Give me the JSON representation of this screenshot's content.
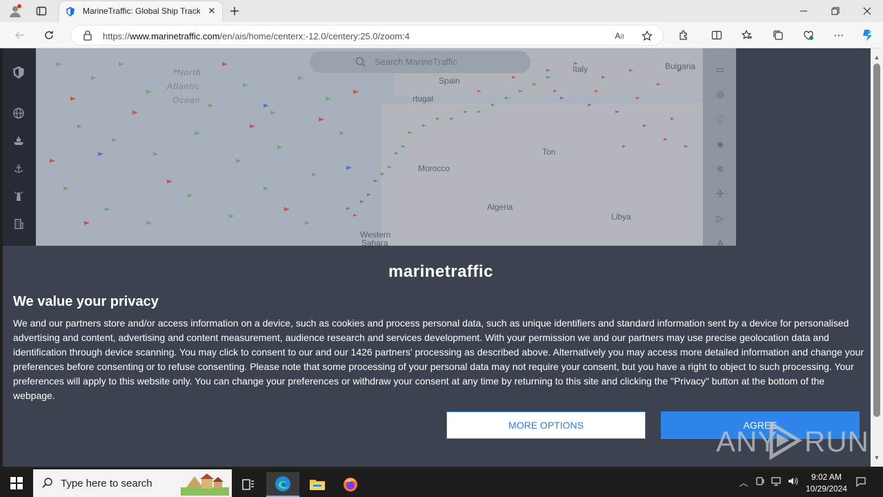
{
  "browser": {
    "tab_title": "MarineTraffic: Global Ship Trackin",
    "url_prefix": "https://",
    "url_domain": "www.marinetraffic.com",
    "url_path": "/en/ais/home/centerx:-12.0/centery:25.0/zoom:4",
    "window_controls": [
      "minimize",
      "restore",
      "close"
    ]
  },
  "map": {
    "search_placeholder": "Search MarineTraffic",
    "labels": {
      "north_atlantic_1": "North",
      "north_atlantic_2": "Atlantic",
      "north_atlantic_3": "Ocean",
      "spain": "Spain",
      "portugal": "rtugal",
      "italy": "Italy",
      "bulgaria": "Bulgaria",
      "morocco": "Morocco",
      "algeria": "Algeria",
      "libya": "Libya",
      "tunisia": "Ton",
      "western_sahara_1": "Western",
      "western_sahara_2": "Sahara"
    }
  },
  "consent": {
    "logo": "marinetraffic",
    "heading": "We value your privacy",
    "body": "We and our partners store and/or access information on a device, such as cookies and process personal data, such as unique identifiers and standard information sent by a device for personalised advertising and content, advertising and content measurement, audience research and services development. With your permission we and our partners may use precise geolocation data and identification through device scanning. You may click to consent to our and our 1426 partners' processing as described above. Alternatively you may access more detailed information and change your preferences before consenting or to refuse consenting. Please note that some processing of your personal data may not require your consent, but you have a right to object to such processing. Your preferences will apply to this website only. You can change your preferences or withdraw your consent at any time by returning to this site and clicking the \"Privacy\" button at the bottom of the webpage.",
    "more_options": "MORE OPTIONS",
    "agree": "AGREE"
  },
  "watermark": {
    "left": "ANY",
    "right": "RUN"
  },
  "taskbar": {
    "search_placeholder": "Type here to search",
    "time": "9:02 AM",
    "date": "10/29/2024"
  },
  "colors": {
    "consent_bg": "#3c4250",
    "agree_bg": "#2f86ea",
    "accent_blue": "#2f7fd8"
  }
}
